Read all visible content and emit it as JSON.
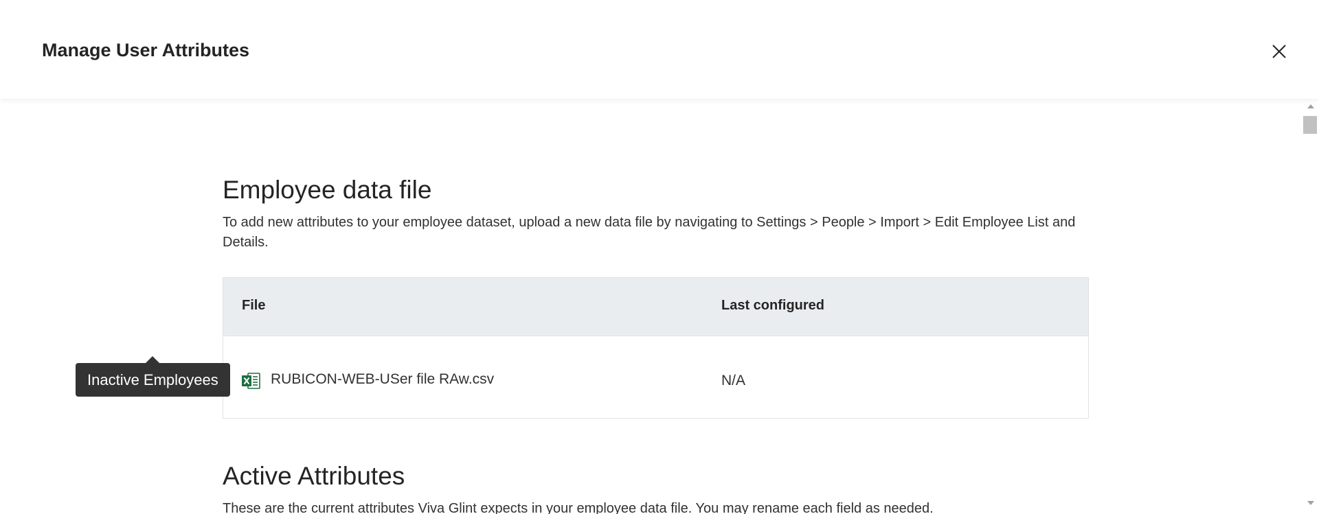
{
  "dialog": {
    "title": "Manage User Attributes",
    "close_icon": "close-icon"
  },
  "employee_data_file": {
    "title": "Employee data file",
    "description": "To add new attributes to your employee dataset, upload a new data file by navigating to Settings > People > Import > Edit Employee List and Details.",
    "table": {
      "columns": [
        "File",
        "Last configured"
      ],
      "rows": [
        {
          "file_icon": "excel-file-icon",
          "file": "RUBICON-WEB-USer file RAw.csv",
          "last_configured": "N/A"
        }
      ]
    }
  },
  "active_attributes": {
    "title": "Active Attributes",
    "description": "These are the current attributes Viva Glint expects in your employee data file. You may rename each field as needed."
  },
  "tooltip": {
    "text": "Inactive Employees"
  },
  "colors": {
    "table_header_bg": "#eaedf0",
    "tooltip_bg": "#333333",
    "excel_green": "#1d6f42"
  }
}
